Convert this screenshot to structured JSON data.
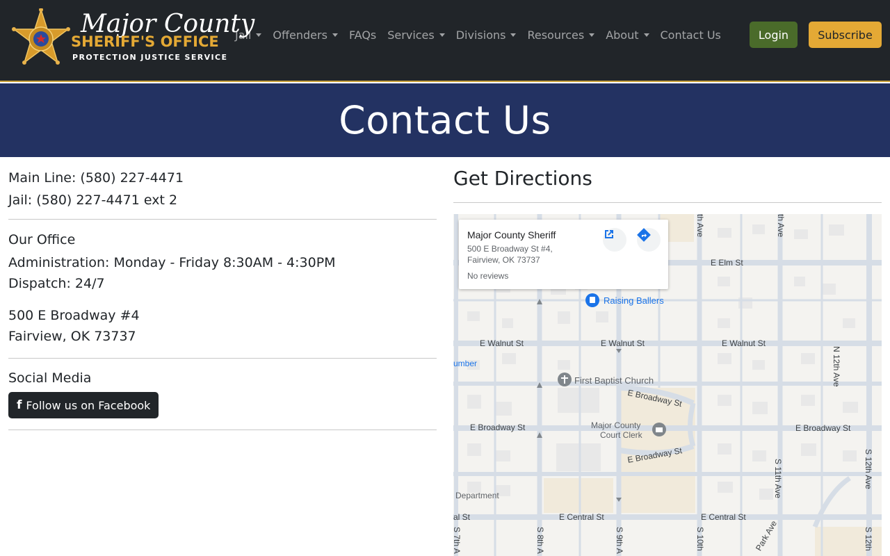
{
  "header": {
    "logo": {
      "script": "Major County",
      "title": "SHERIFF'S OFFICE",
      "tagline": "PROTECTION  JUSTICE  SERVICE",
      "badge_text": "SHERIFF · MAJOR COUNTY · OKLAHOMA"
    },
    "nav": [
      {
        "label": "Jail",
        "dropdown": true
      },
      {
        "label": "Offenders",
        "dropdown": true
      },
      {
        "label": "FAQs",
        "dropdown": false
      },
      {
        "label": "Services",
        "dropdown": true
      },
      {
        "label": "Divisions",
        "dropdown": true
      },
      {
        "label": "Resources",
        "dropdown": true
      },
      {
        "label": "About",
        "dropdown": true
      },
      {
        "label": "Contact Us",
        "dropdown": false
      }
    ],
    "login_label": "Login",
    "subscribe_label": "Subscribe"
  },
  "hero": {
    "title": "Contact Us"
  },
  "contact": {
    "main_line": "Main Line: (580) 227-4471",
    "jail_line": "Jail: (580) 227-4471 ext 2",
    "office_title": "Our Office",
    "admin_hours": "Administration: Monday - Friday 8:30AM - 4:30PM",
    "dispatch_hours": "Dispatch: 24/7",
    "address_line1": "500 E Broadway #4",
    "address_line2": "Fairview, OK 73737",
    "social_title": "Social Media",
    "facebook_label": "Follow us on Facebook"
  },
  "directions": {
    "title": "Get Directions",
    "card": {
      "name": "Major County Sheriff",
      "address_line1": "500 E Broadway St #4,",
      "address_line2": "Fairview, OK 73737",
      "reviews": "No reviews"
    },
    "map_labels": {
      "e_elm": "E Elm St",
      "raising_ballers": "Raising Ballers",
      "e_walnut_1": "E Walnut St",
      "e_walnut_2": "E Walnut St",
      "e_walnut_3": "E Walnut St",
      "lumber": "umber",
      "first_baptist": "First Baptist Church",
      "e_broadway_curve_top": "E Broadway St",
      "e_broadway_left": "E Broadway St",
      "court_clerk_1": "Major County",
      "court_clerk_2": "Court Clerk",
      "e_broadway_right": "E Broadway St",
      "e_broadway_curve_bottom": "E Broadway St",
      "department": "Department",
      "e_central_left": "al St",
      "e_central_1": "E Central St",
      "e_central_2": "E Central St",
      "n_12th": "N 12th Ave",
      "s_12th": "S 12th Ave",
      "s_11th": "S 11th Ave",
      "th_ave_1": "th Ave",
      "th_ave_2": "th Ave",
      "s_7th": "S 7th A",
      "s_8th": "S 8th A",
      "s_9th": "S 9th A",
      "s_10th": "S 10th",
      "park_ave": "Park Ave",
      "s_12th_bottom": "S 12th"
    }
  },
  "colors": {
    "navbar_bg": "#212529",
    "accent_gold": "#e4a935",
    "hero_bg": "#233262",
    "login_green": "#4a6b2a"
  }
}
